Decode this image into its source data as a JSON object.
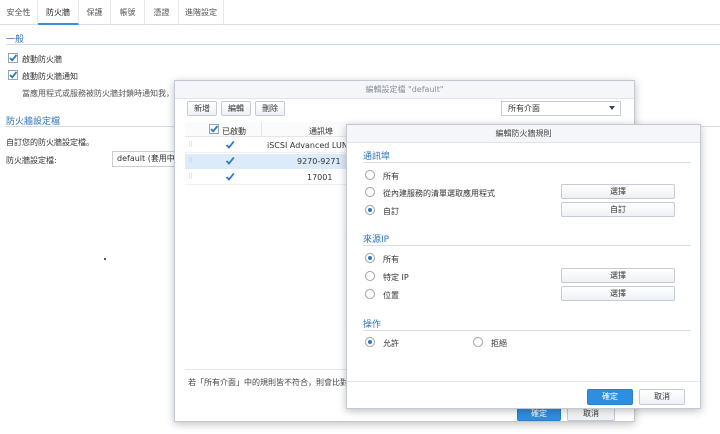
{
  "tabs": [
    {
      "label": "安全性"
    },
    {
      "label": "防火牆"
    },
    {
      "label": "保護"
    },
    {
      "label": "帳號"
    },
    {
      "label": "憑證"
    },
    {
      "label": "進階設定"
    }
  ],
  "general": {
    "title": "一般",
    "enable_firewall": "啟動防火牆",
    "enable_firewall_notify": "啟動防火牆通知",
    "notify_desc": "當應用程式或服務被防火牆封鎖時通知我，並提"
  },
  "profile": {
    "title": "防火牆設定檔",
    "custom_label": "自訂您的防火牆設定檔。",
    "profile_label": "防火牆設定檔:",
    "profile_value": "default (套用中的"
  },
  "edit_profile": {
    "title": "編輯設定檔 \"default\"",
    "toolbar": {
      "add": "新增",
      "edit": "編輯",
      "delete": "刪除"
    },
    "interface": "所有介面",
    "columns": {
      "enabled": "已啟動",
      "ports": "通訊埠"
    },
    "rows": [
      {
        "ports": "iSCSI Advanced LUN re"
      },
      {
        "ports": "9270-9271"
      },
      {
        "ports": "17001"
      }
    ],
    "footer_note": "若「所有介面」中的規則皆不符合，則會比對各個介",
    "ok": "確定",
    "cancel": "取消"
  },
  "rule": {
    "title": "編輯防火牆規則",
    "ports": {
      "title": "通訊埠",
      "all": "所有",
      "from_list": "從內建服務的清單選取應用程式",
      "custom": "自訂",
      "select_btn": "選擇",
      "custom_btn": "自訂"
    },
    "source_ip": {
      "title": "來源IP",
      "all": "所有",
      "specific": "特定 IP",
      "location": "位置",
      "select_btn1": "選擇",
      "select_btn2": "選擇"
    },
    "action": {
      "title": "操作",
      "allow": "允許",
      "deny": "拒絕"
    },
    "ok": "確定",
    "cancel": "取消"
  }
}
